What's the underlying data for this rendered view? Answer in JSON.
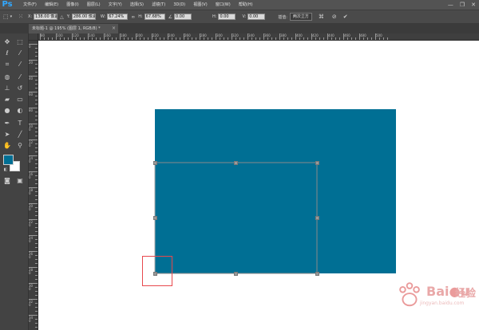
{
  "app": {
    "logo": "Ps"
  },
  "menu": [
    "文件(F)",
    "编辑(E)",
    "图像(I)",
    "图层(L)",
    "文字(Y)",
    "选择(S)",
    "滤镜(T)",
    "3D(D)",
    "视图(V)",
    "窗口(W)",
    "帮助(H)"
  ],
  "window_controls": {
    "minimize": "—",
    "restore": "❐",
    "close": "✕"
  },
  "options": {
    "x_label": "X:",
    "x_value": "138.00 像素",
    "y_label": "Y:",
    "y_value": "286.00 像素",
    "w_label": "W:",
    "w_value": "67.24%",
    "h_label": "H:",
    "h_value": "67.68%",
    "angle_value": "0.00",
    "hskew_label": "H:",
    "hskew_value": "0.00",
    "vskew_label": "V:",
    "vskew_value": "0.00",
    "interp_label": "插值:",
    "interp_value": "两次立方"
  },
  "document": {
    "tab_title": "未标题-1 @ 195% (图层 1, RGB/8) *",
    "close_glyph": "×"
  },
  "ruler_top_labels": [
    "80",
    "100",
    "120",
    "140",
    "160",
    "180",
    "200",
    "220",
    "240",
    "260",
    "280",
    "300",
    "320",
    "340",
    "360",
    "380",
    "400",
    "420",
    "440",
    "460",
    "480",
    "500"
  ],
  "ruler_left_labels": [
    "0",
    "20",
    "40",
    "60",
    "80",
    "100",
    "120",
    "140",
    "160",
    "180",
    "200",
    "220",
    "240",
    "260",
    "280",
    "300",
    "320",
    "340"
  ],
  "colors": {
    "shape_fill": "#006f94",
    "foreground": "#006f94",
    "background": "#ffffff",
    "highlight": "#e8484d"
  },
  "watermark": {
    "brand_latin": "Bai",
    "brand_latin2": "u",
    "brand_cn": "经验",
    "url": "jingyan.baidu.com"
  }
}
